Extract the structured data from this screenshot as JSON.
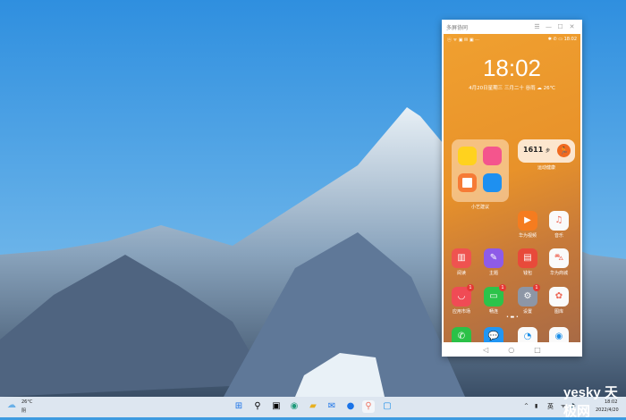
{
  "window": {
    "title": "多屏协同",
    "menu": "☰",
    "minimize": "—",
    "maximize": "☐",
    "close": "✕"
  },
  "phone": {
    "status_left": "ⓝ ᯤ ▣ ✉ ▣ ···",
    "status_right": "✱ ✆ ▭ 18:02",
    "time": "18:02",
    "date": "4月20日星期三  三月二十  谷雨",
    "weather": "☁ 26℃",
    "folder_label": "小艺建议",
    "steps": "1611",
    "steps_unit": "步",
    "health_label": "运动健康",
    "apps": [
      {
        "label": "华为视频",
        "color": "#f57c1f",
        "glyph": "▶"
      },
      {
        "label": "音乐",
        "color": "#fafafa",
        "glyph": "♫"
      },
      {
        "label": "阅读",
        "color": "#ef5350",
        "glyph": "▥"
      },
      {
        "label": "主题",
        "color": "#8e5be8",
        "glyph": "✎"
      },
      {
        "label": "钱包",
        "color": "#e84a3a",
        "glyph": "▤"
      },
      {
        "label": "华为商城",
        "color": "#fafafa",
        "glyph": "⛍"
      },
      {
        "label": "应用市场",
        "color": "#f04b55",
        "glyph": "◡",
        "badge": "1"
      },
      {
        "label": "畅连",
        "color": "#2cc34a",
        "glyph": "▭",
        "badge": "1"
      },
      {
        "label": "设置",
        "color": "#8d96a6",
        "glyph": "⚙",
        "badge": "1"
      },
      {
        "label": "图库",
        "color": "#fafafa",
        "glyph": "✿"
      }
    ],
    "dock": [
      {
        "name": "phone",
        "color": "#2bc147",
        "glyph": "✆"
      },
      {
        "name": "messages",
        "color": "#2196f3",
        "glyph": "💬"
      },
      {
        "name": "browser",
        "color": "#fafafa",
        "glyph": "◔"
      },
      {
        "name": "camera",
        "color": "#fafafa",
        "glyph": "◉"
      }
    ],
    "nav": [
      "◁",
      "○",
      "□"
    ]
  },
  "taskbar": {
    "weather_temp": "26°C",
    "weather_desc": "阴",
    "lang": "英",
    "time": "18:02",
    "date": "2022/4/20",
    "watermark": "yesky 天极网"
  }
}
